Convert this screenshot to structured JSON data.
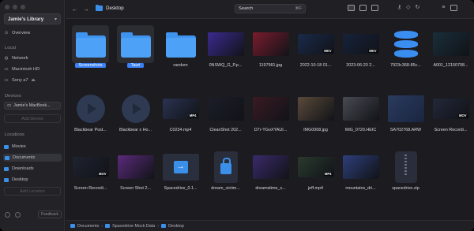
{
  "sidebar": {
    "library_label": "Jamie's Library",
    "overview_label": "Overview",
    "locations_section_title": "Local",
    "local_items": [
      "Network",
      "Macintosh HD",
      "Sony a7"
    ],
    "devices_section_title": "Devices",
    "device_label": "Jamie's MacBook...",
    "add_device_label": "Add Device",
    "locations_title": "Locations",
    "location_items": [
      "Movies",
      "Documents",
      "Downloads",
      "Desktop"
    ],
    "add_location_label": "Add Location",
    "feedback_label": "Feedback"
  },
  "topbar": {
    "path_title": "Desktop",
    "search_placeholder": "Search",
    "search_shortcut": "⌘F"
  },
  "items": [
    {
      "name": "Screenshots",
      "kind": "folder",
      "selected": true
    },
    {
      "name": "Tauri",
      "kind": "folder",
      "selected": true
    },
    {
      "name": "random",
      "kind": "folder"
    },
    {
      "name": "0NSWQ_G_P.p...",
      "kind": "image",
      "color": "#3b2a8f"
    },
    {
      "name": "1197981.jpg",
      "kind": "image",
      "color": "#7a1c2e"
    },
    {
      "name": "2022-10-18 01...",
      "kind": "video",
      "color": "#1a2a4a",
      "tag": "MKV"
    },
    {
      "name": "2023-06-20 2...",
      "kind": "video",
      "color": "#16223a",
      "tag": "MKV"
    },
    {
      "name": "7923c368-85c...",
      "kind": "db"
    },
    {
      "name": "A001_12150708...",
      "kind": "image",
      "color": "#1a2e3a"
    },
    {
      "name": "Blackbear Post...",
      "kind": "play"
    },
    {
      "name": "Blackbear x Ho...",
      "kind": "play"
    },
    {
      "name": "C0234.mp4",
      "kind": "video",
      "color": "#2a3350",
      "tag": "MP4"
    },
    {
      "name": "CleanShot 202...",
      "kind": "image",
      "color": "#1c1e28"
    },
    {
      "name": "D7r-YGoXYAUI...",
      "kind": "image",
      "color": "#3a1a22"
    },
    {
      "name": "IMG0068.jpg",
      "kind": "image",
      "color": "#5a4a3a"
    },
    {
      "name": "IMG_0720.HEIC",
      "kind": "image",
      "color": "#4a4a52"
    },
    {
      "name": "SA702768.ARW",
      "kind": "raw"
    },
    {
      "name": "Screen Recordi...",
      "kind": "video",
      "color": "#23283a",
      "tag": "MOV"
    },
    {
      "name": "Screen Recordi...",
      "kind": "video",
      "color": "#1f2330",
      "tag": "MOV"
    },
    {
      "name": "Screen Shot 2...",
      "kind": "image",
      "color": "#5a2a7a"
    },
    {
      "name": "Spacedrive_0.1...",
      "kind": "dmg"
    },
    {
      "name": "dream_victim...",
      "kind": "lock"
    },
    {
      "name": "dreamstime_x...",
      "kind": "image",
      "color": "#3a2a6a"
    },
    {
      "name": "jeff.mp4",
      "kind": "video",
      "color": "#2a3a2e",
      "tag": "MP4"
    },
    {
      "name": "mountains_dri...",
      "kind": "image",
      "color": "#2d3f7a"
    },
    {
      "name": "spacedrive.zip",
      "kind": "zip"
    }
  ],
  "pathbar": {
    "segments": [
      "Documents",
      "Spacedrive Mock Data",
      "Desktop"
    ]
  }
}
